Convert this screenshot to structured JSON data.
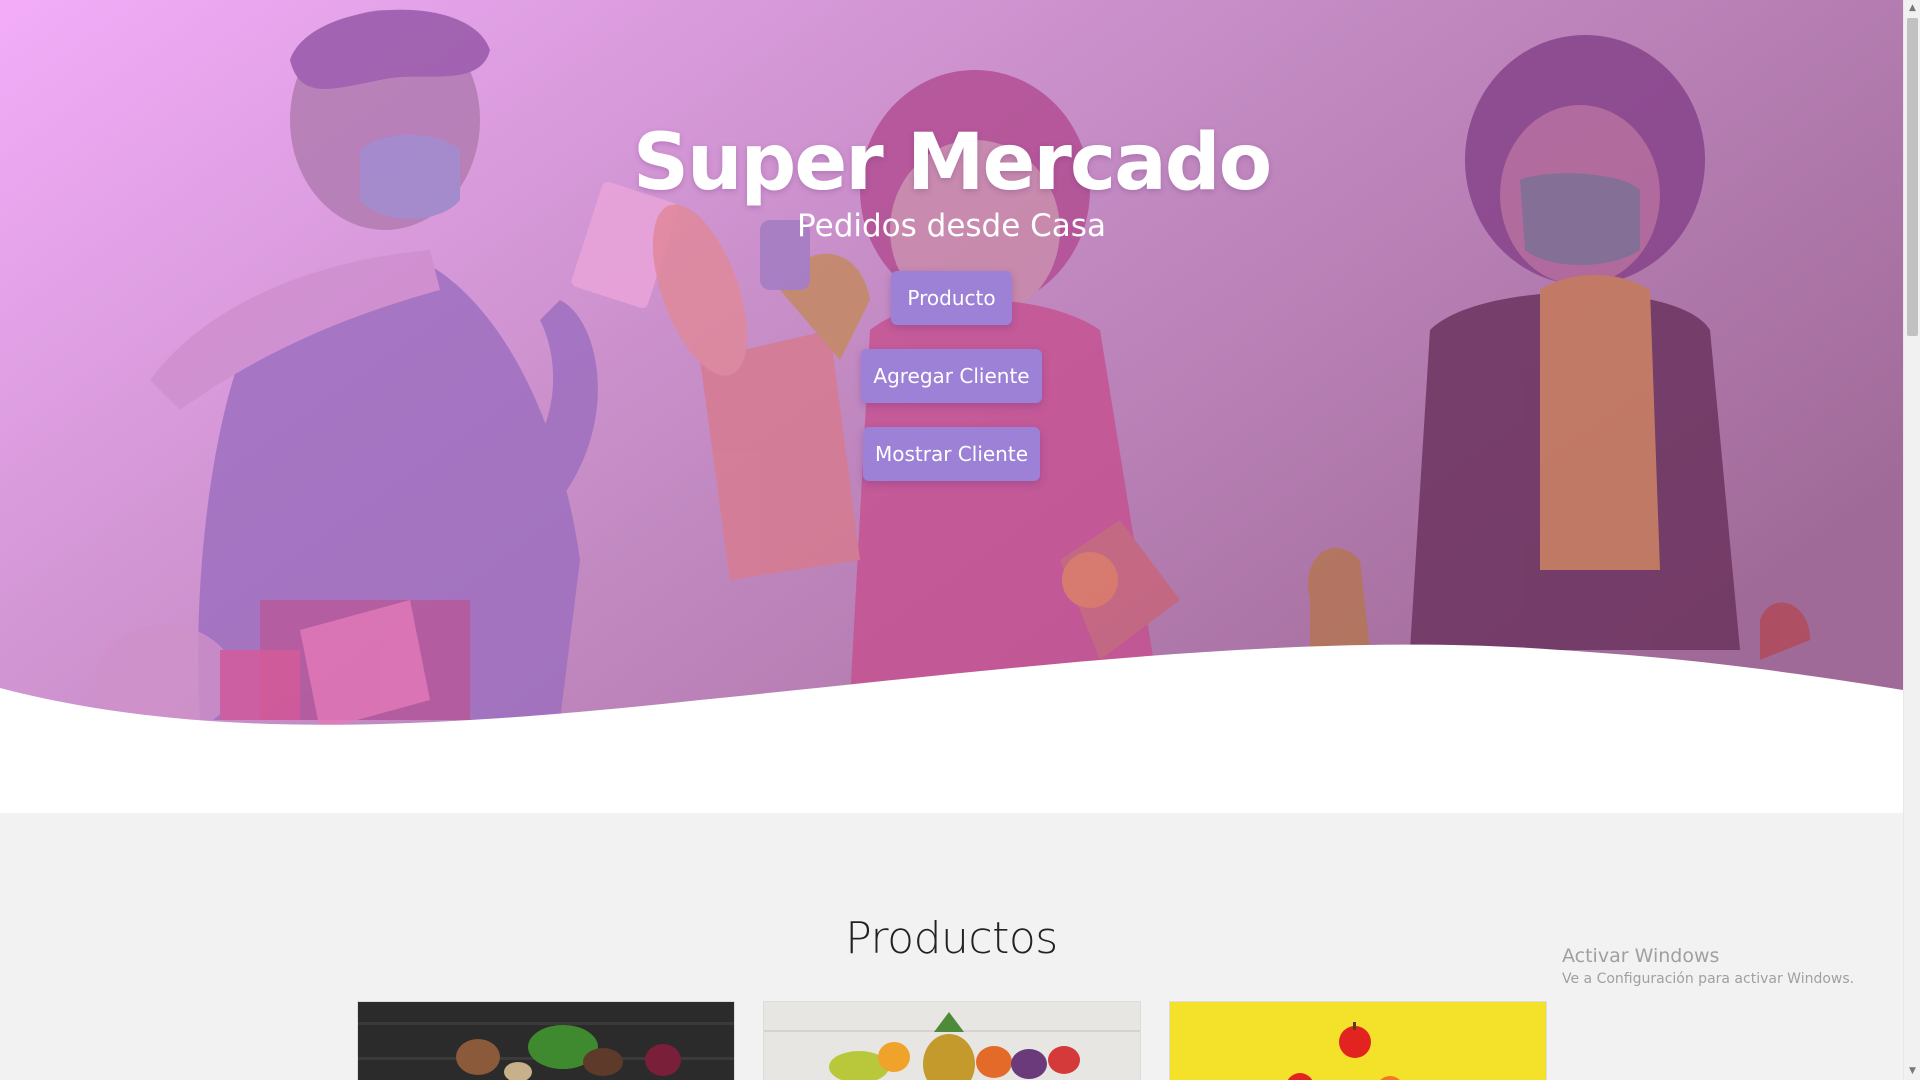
{
  "hero": {
    "title": "Super Mercado",
    "subtitle": "Pedidos desde Casa",
    "buttons": [
      {
        "label": "Producto"
      },
      {
        "label": "Agregar Cliente"
      },
      {
        "label": "Mostrar Cliente"
      }
    ],
    "colors": {
      "gradient_start": "#f3adf9",
      "gradient_end": "#a06a98",
      "button_bg": "#9c81d6"
    }
  },
  "products": {
    "title": "Productos",
    "cards": [
      {
        "image": "vegetables-on-dark-wood"
      },
      {
        "image": "fruits-assortment"
      },
      {
        "image": "fruits-on-yellow"
      }
    ]
  },
  "watermark": {
    "title": "Activar Windows",
    "subtitle": "Ve a Configuración para activar Windows."
  }
}
